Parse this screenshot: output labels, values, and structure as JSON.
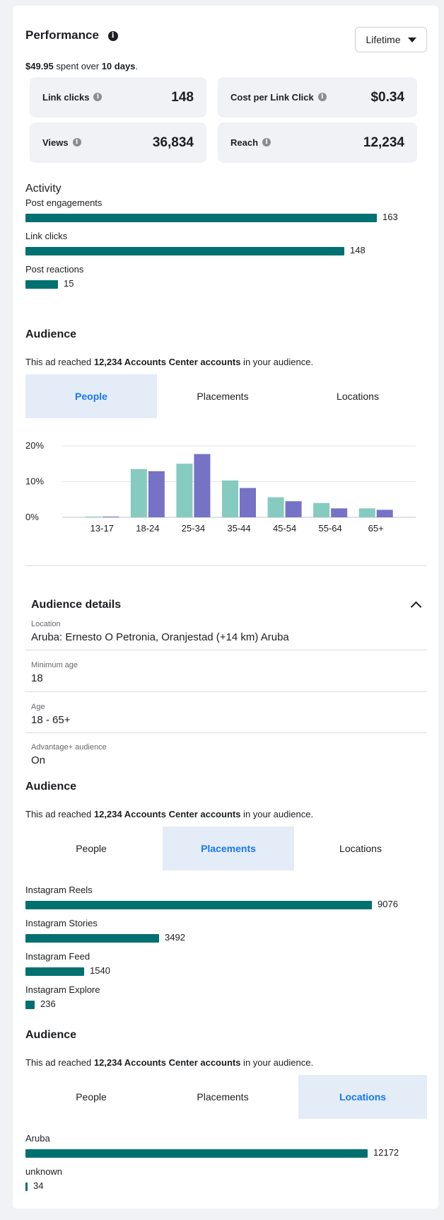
{
  "performance": {
    "title": "Performance",
    "dropdown": "Lifetime",
    "spent_amount": "$49.95",
    "spent_mid": " spent over ",
    "spent_days": "10 days",
    "spent_end": ".",
    "metrics": [
      {
        "label": "Link clicks",
        "value": "148"
      },
      {
        "label": "Cost per Link Click",
        "value": "$0.34"
      },
      {
        "label": "Views",
        "value": "36,834"
      },
      {
        "label": "Reach",
        "value": "12,234"
      }
    ]
  },
  "activity": {
    "title": "Activity",
    "max": 163,
    "items": [
      {
        "label": "Post engagements",
        "value": 163
      },
      {
        "label": "Link clicks",
        "value": 148
      },
      {
        "label": "Post reactions",
        "value": 15
      }
    ]
  },
  "audience": {
    "title": "Audience",
    "reached_pre": "This ad reached ",
    "reached_bold": "12,234 Accounts Center accounts",
    "reached_post": " in your audience.",
    "tabs": [
      "People",
      "Placements",
      "Locations"
    ]
  },
  "chart_data": {
    "type": "bar",
    "categories": [
      "13-17",
      "18-24",
      "25-34",
      "35-44",
      "45-54",
      "55-64",
      "65+"
    ],
    "series": [
      {
        "values": [
          0.2,
          13.5,
          15.0,
          10.3,
          5.6,
          4.0,
          2.5
        ],
        "color": "#86cbbf"
      },
      {
        "values": [
          0.2,
          12.9,
          17.7,
          8.2,
          4.5,
          2.5,
          2.1
        ],
        "color": "#7672c5"
      }
    ],
    "ylim": [
      0,
      20
    ],
    "yticks": [
      "0%",
      "10%",
      "20%"
    ],
    "grid": true,
    "xlabel": "",
    "ylabel": ""
  },
  "details": {
    "title": "Audience details",
    "fields": [
      {
        "label": "Location",
        "value": "Aruba: Ernesto O Petronia, Oranjestad (+14 km) Aruba"
      },
      {
        "label": "Minimum age",
        "value": "18"
      },
      {
        "label": "Age",
        "value": "18 - 65+"
      },
      {
        "label": "Advantage+ audience",
        "value": "On"
      }
    ]
  },
  "placements": {
    "max": 9076,
    "items": [
      {
        "label": "Instagram Reels",
        "value": 9076
      },
      {
        "label": "Instagram Stories",
        "value": 3492
      },
      {
        "label": "Instagram Feed",
        "value": 1540
      },
      {
        "label": "Instagram Explore",
        "value": 236
      }
    ]
  },
  "locations": {
    "max": 12172,
    "items": [
      {
        "label": "Aruba",
        "value": 12172
      },
      {
        "label": "unknown",
        "value": 34
      }
    ]
  },
  "colors": {
    "bar": "#007070",
    "active_tab_text": "#1877f2",
    "active_tab_bg": "#e3ecf7"
  }
}
